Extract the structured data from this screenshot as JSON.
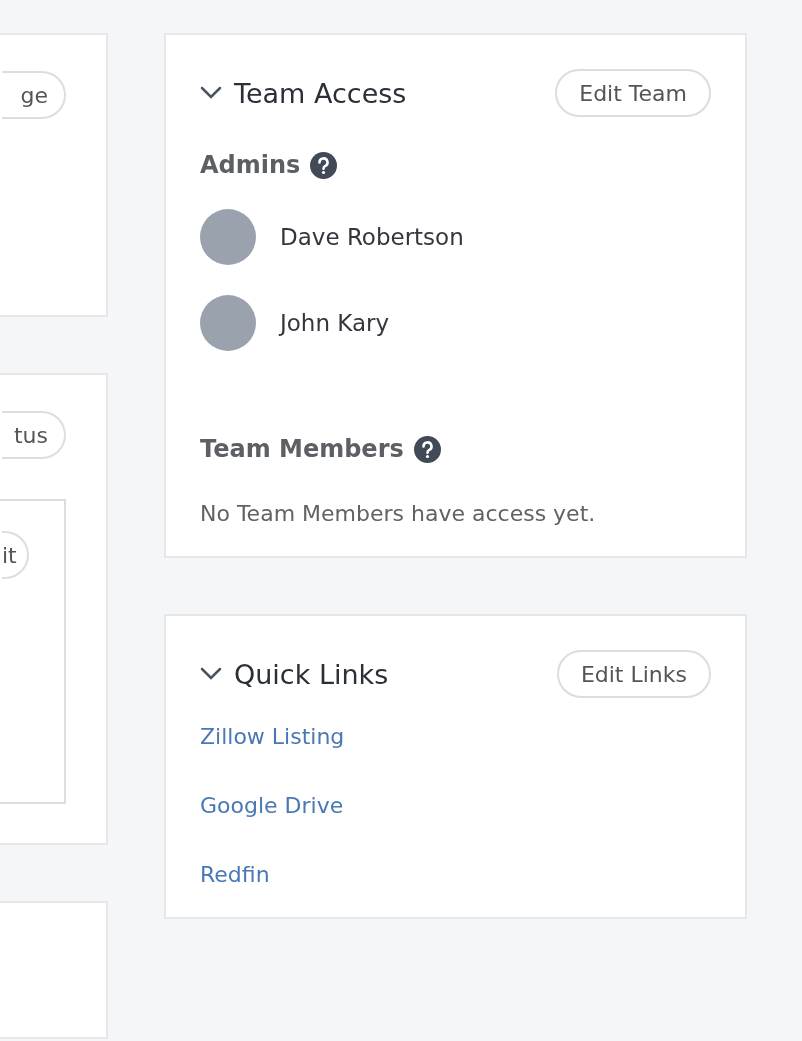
{
  "left_column": {
    "cards": [
      {
        "button": "ge"
      },
      {
        "button": "tus",
        "inner_button": "it"
      }
    ]
  },
  "team_access": {
    "title": "Team Access",
    "expanded": true,
    "edit_button": "Edit Team",
    "admins": {
      "heading": "Admins",
      "people": [
        {
          "name": "Dave Robertson"
        },
        {
          "name": "John Kary"
        }
      ]
    },
    "team_members": {
      "heading": "Team Members",
      "empty_text": "No Team Members have access yet."
    }
  },
  "quick_links": {
    "title": "Quick Links",
    "expanded": true,
    "edit_button": "Edit Links",
    "links": [
      {
        "label": "Zillow Listing"
      },
      {
        "label": "Google Drive"
      },
      {
        "label": "Redfin"
      }
    ]
  }
}
